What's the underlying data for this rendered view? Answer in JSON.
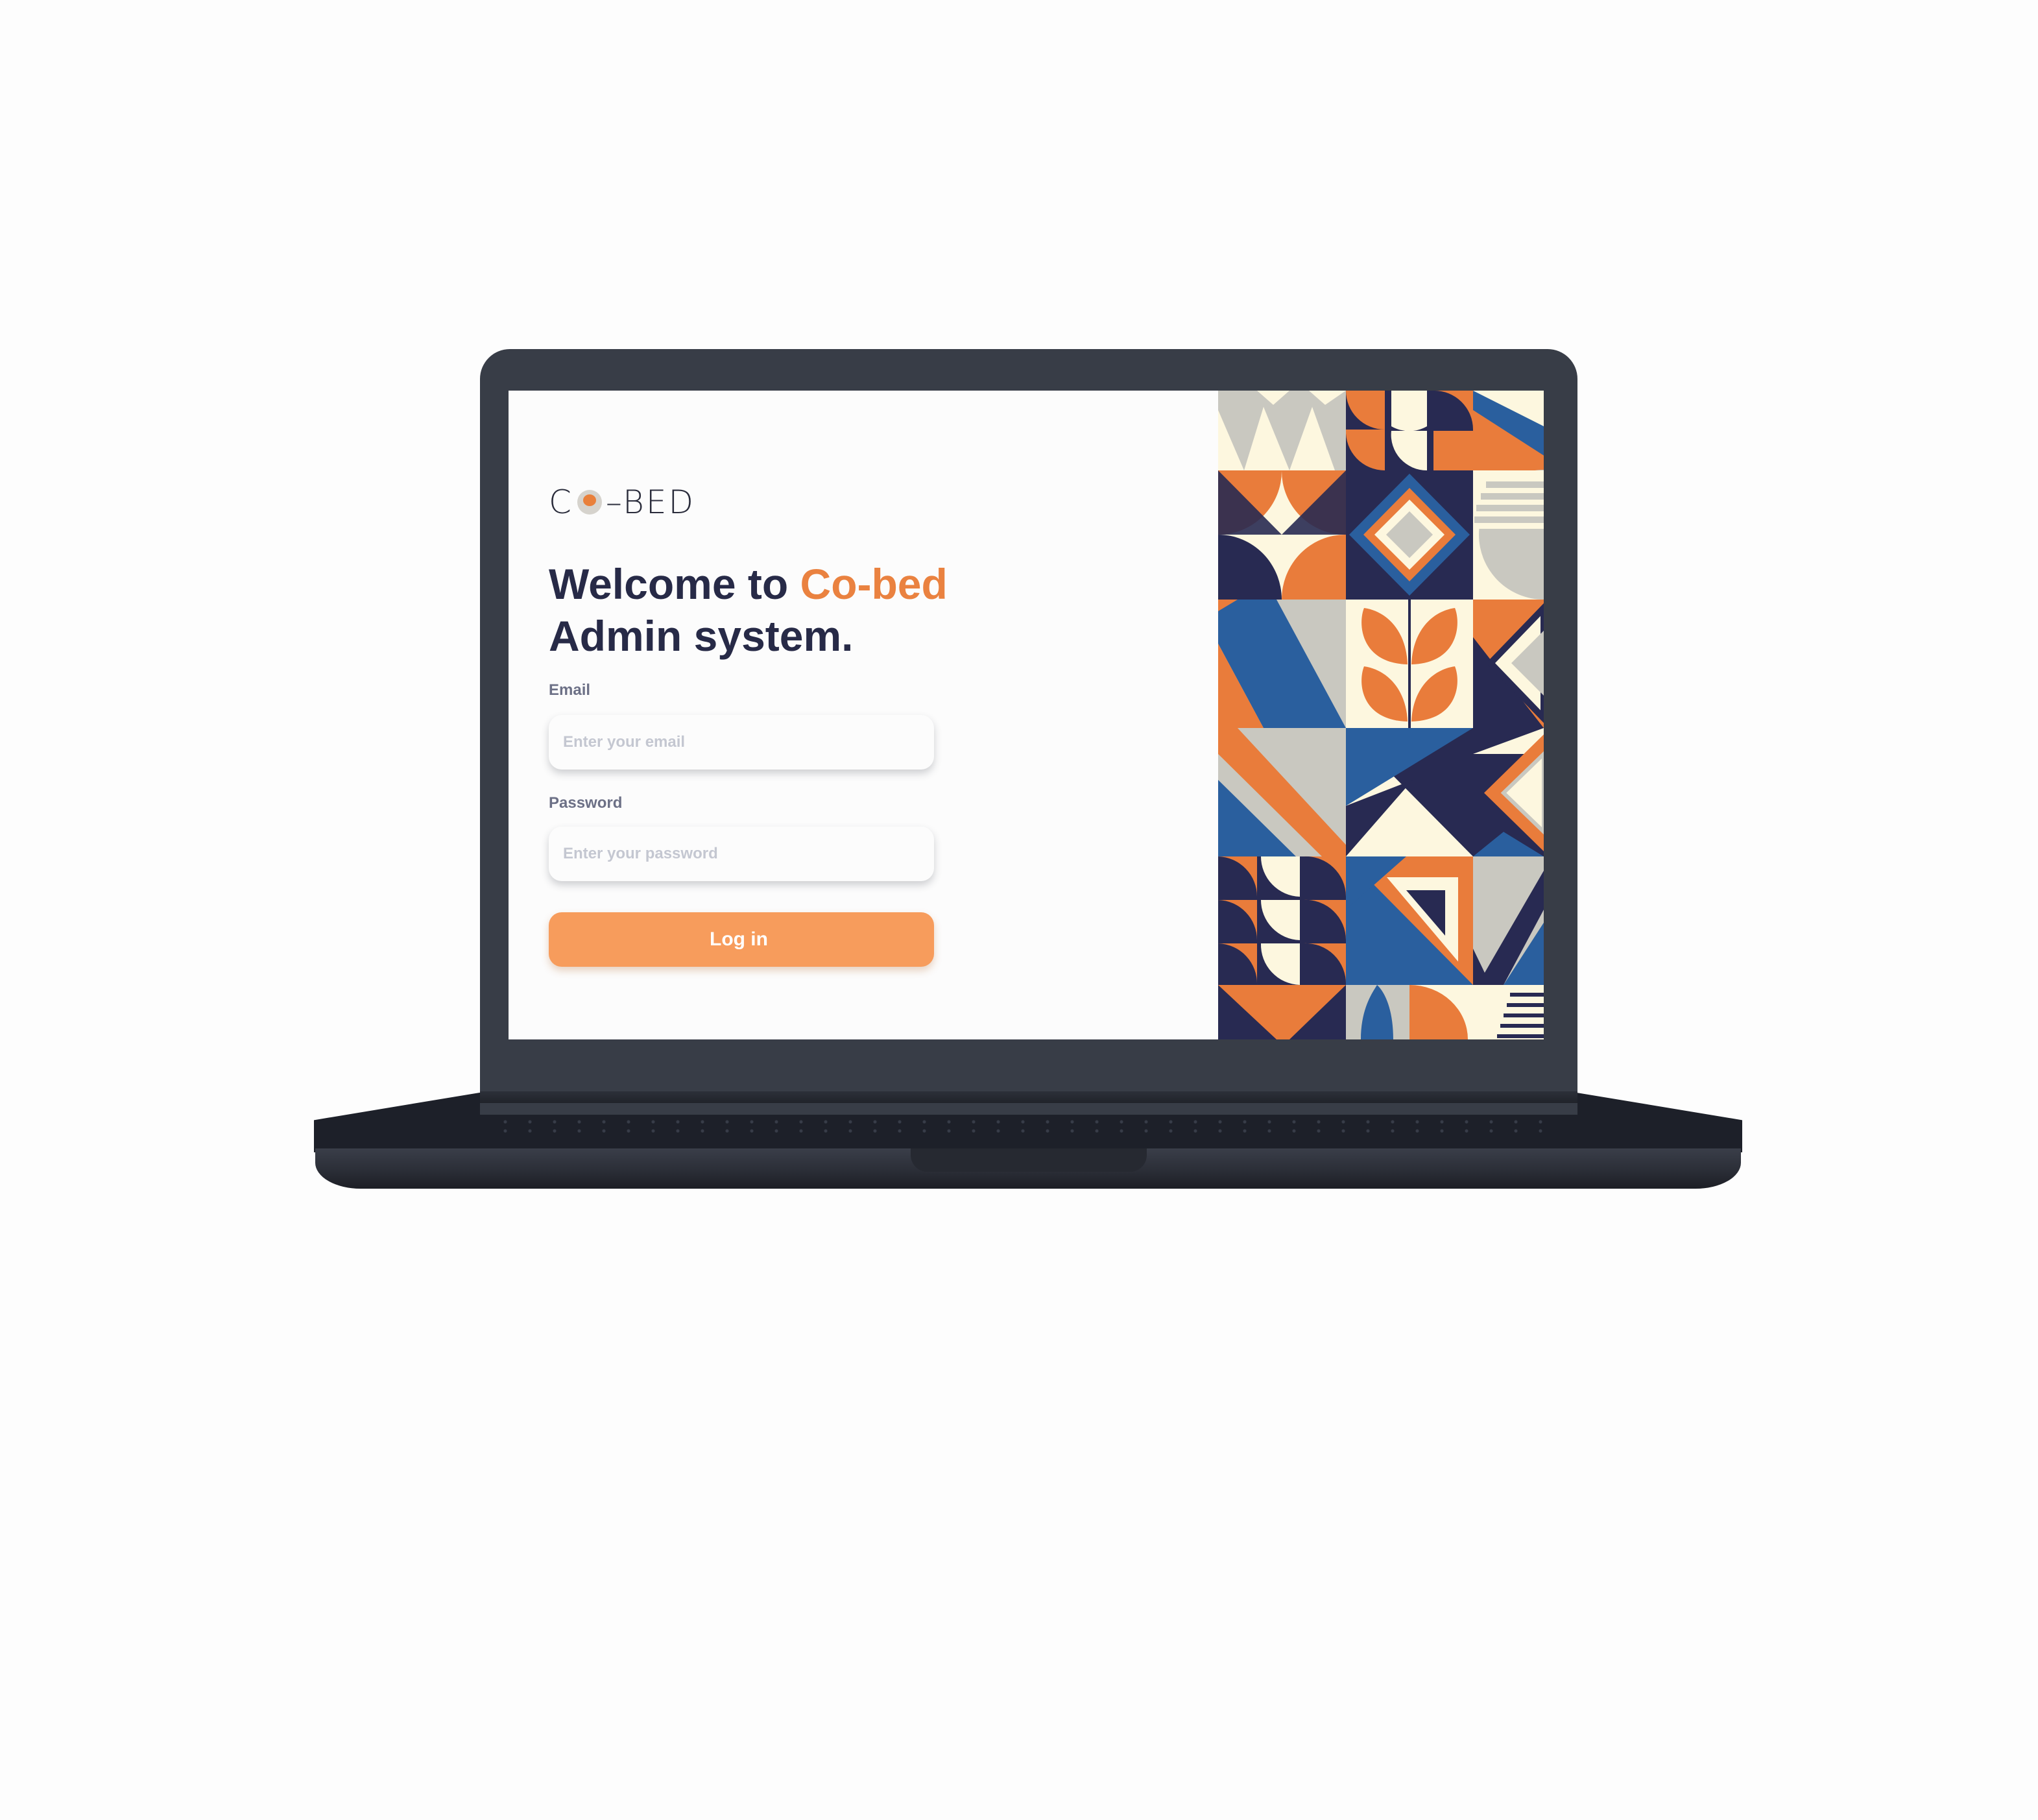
{
  "brand": {
    "logo_text_left": "C",
    "logo_text_right": "–BED"
  },
  "login": {
    "title_prefix": "Welcome to ",
    "title_accent": "Co-bed",
    "title_suffix": "Admin system.",
    "email_label": "Email",
    "email_placeholder": "Enter your email",
    "password_label": "Password",
    "password_placeholder": "Enter your password",
    "submit_label": "Log in"
  },
  "colors": {
    "accent": "#ea8240",
    "button": "#f79c5c",
    "heading": "#272a47",
    "device": "#383d47",
    "mosaic": [
      "#e97c3b",
      "#2a5f9e",
      "#282a52",
      "#fdf7df",
      "#c9c8c0"
    ]
  },
  "icons": {
    "logo_mark": "cobed-logo-icon"
  }
}
